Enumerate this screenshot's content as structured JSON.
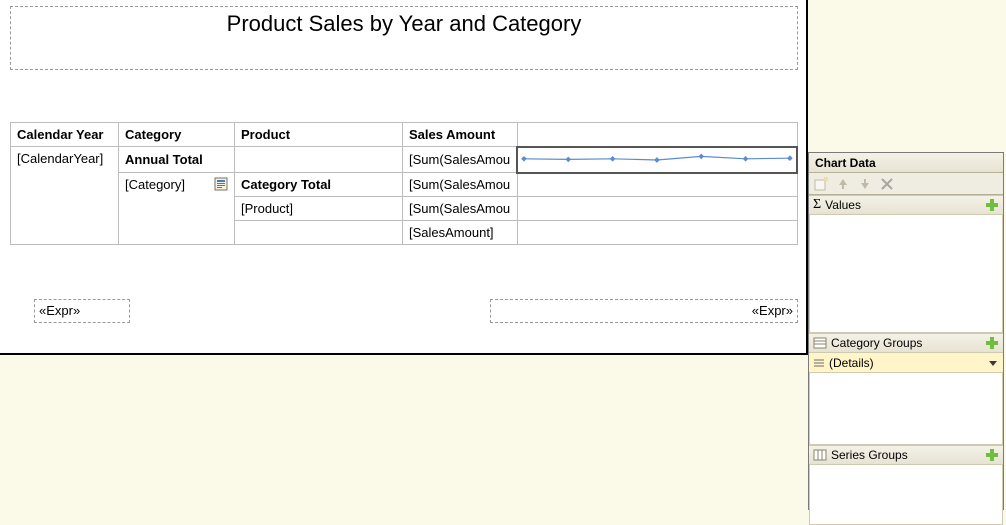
{
  "report": {
    "title": "Product Sales by Year and Category",
    "headers": {
      "col1": "Calendar Year",
      "col2": "Category",
      "col3": "Product",
      "col4": "Sales Amount"
    },
    "rows": {
      "r1c1": "[CalendarYear]",
      "r1c2": "Annual Total",
      "r1c4": "[Sum(SalesAmou",
      "r2c2": "[Category]",
      "r2c3": "Category Total",
      "r2c4": "[Sum(SalesAmou",
      "r3c3": "[Product]",
      "r3c4": "[Sum(SalesAmou",
      "r4c4": "[SalesAmount]"
    },
    "footer": {
      "left": "«Expr»",
      "right": "«Expr»"
    }
  },
  "chart_panel": {
    "title": "Chart Data",
    "sections": {
      "values": "Values",
      "category_groups": "Category Groups",
      "series_groups": "Series Groups",
      "details": "(Details)"
    }
  },
  "chart_data": {
    "type": "line",
    "x": [
      0,
      1,
      2,
      3,
      4,
      5,
      6
    ],
    "values": [
      12,
      11,
      12,
      10,
      16,
      12,
      13
    ],
    "ylim": [
      0,
      20
    ]
  }
}
